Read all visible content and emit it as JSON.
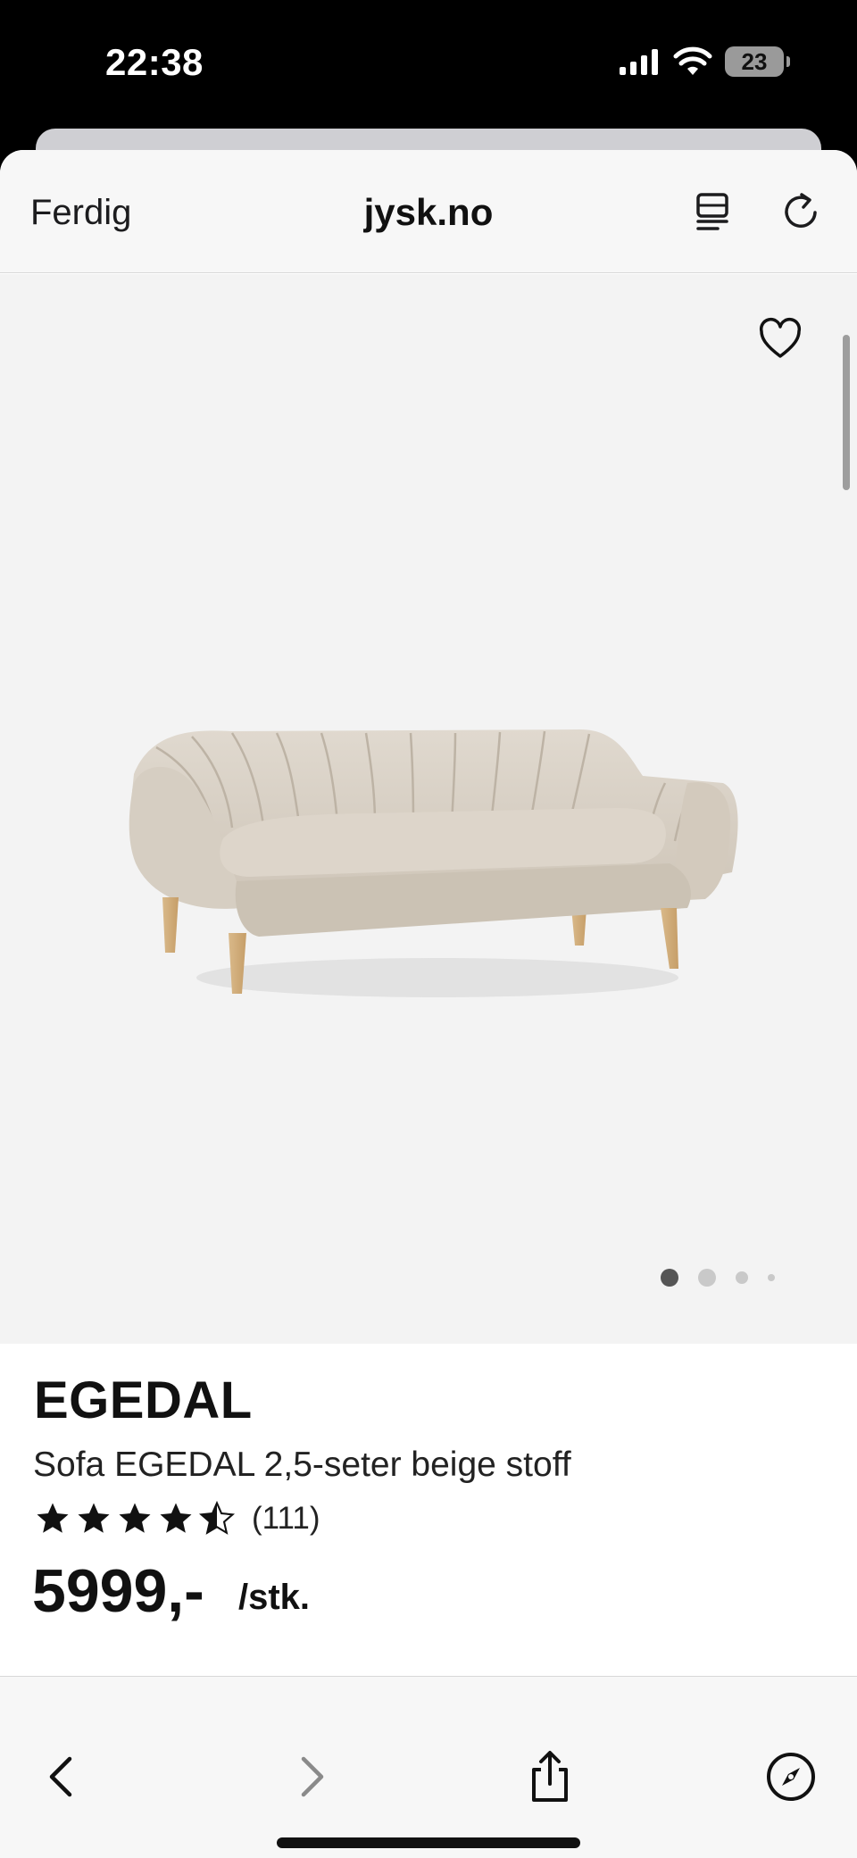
{
  "status_bar": {
    "time": "22:38",
    "battery": "23",
    "icons": [
      "signal-icon",
      "wifi-icon",
      "battery-icon"
    ]
  },
  "browser": {
    "done_label": "Ferdig",
    "domain": "jysk.no",
    "icons": [
      "reader-mode-icon",
      "reload-icon"
    ]
  },
  "gallery": {
    "favorite_icon": "heart-icon",
    "image": "sofa-product-image",
    "dot_count": 4,
    "active_dot": 0
  },
  "product": {
    "brand": "EGEDAL",
    "name": "Sofa EGEDAL 2,5-seter beige stoff",
    "rating": 4.5,
    "max_rating": 5,
    "review_count": "(111)",
    "price": "5999,-",
    "unit": "/stk."
  },
  "toolbar": {
    "icons": [
      "back-icon",
      "forward-icon",
      "share-icon",
      "compass-icon"
    ]
  },
  "colors": {
    "text": "#111111",
    "image_bg": "#f3f3f3",
    "bar_bg": "#f7f7f7"
  }
}
